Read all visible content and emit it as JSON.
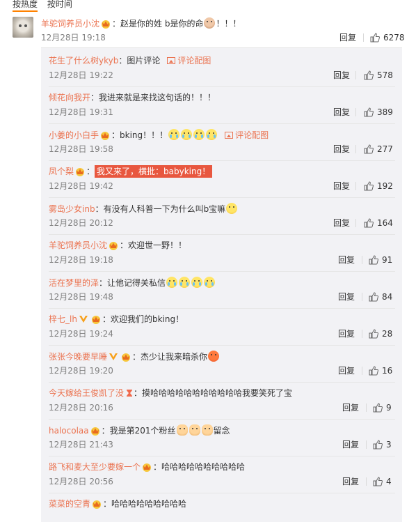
{
  "sort_tabs": [
    {
      "label": "按热度",
      "active": true
    },
    {
      "label": "按时间",
      "active": false
    }
  ],
  "colors": {
    "username": "#eb7350",
    "text": "#333333",
    "meta": "#808080",
    "highlight_bg": "#e8573f",
    "reply_bg": "#f2f2f5",
    "tab_underline": "#ff8200"
  },
  "main_comment": {
    "username": "羊驼饲养员小沈",
    "badges": [
      "vip-crown-icon"
    ],
    "text": "：赵是你的姓 b是你的命",
    "text_suffix": "！！！",
    "emoji_after": [
      "monkey-emoji"
    ],
    "time": "12月28日 19:18",
    "reply_label": "回复",
    "likes": "6278"
  },
  "replies": [
    {
      "username": "花生了什么树ykyb",
      "badges": [],
      "text": "：图片评论",
      "pic_link": "评论配图",
      "emojis": [],
      "time": "12月28日 19:22",
      "reply_label": "回复",
      "likes": "578"
    },
    {
      "username": "倾花向我开",
      "badges": [],
      "text": "：我进来就是来找这句话的！！！",
      "emojis": [],
      "time": "12月28日 19:31",
      "reply_label": "回复",
      "likes": "389"
    },
    {
      "username": "小姜的小白手",
      "badges": [
        "vip-crown-icon"
      ],
      "text": "：bking！！！",
      "pic_link": "评论配图",
      "emojis": [
        "cry-laugh-emoji",
        "cry-laugh-emoji",
        "cry-laugh-emoji",
        "cry-laugh-emoji"
      ],
      "time": "12月28日 19:58",
      "reply_label": "回复",
      "likes": "277"
    },
    {
      "username": "凤个梨",
      "badges": [
        "vip-crown-icon"
      ],
      "text": "：",
      "highlight": "我又来了，横批：babyking！",
      "emojis": [],
      "time": "12月28日 19:42",
      "reply_label": "回复",
      "likes": "192"
    },
    {
      "username": "雾岛少女inb",
      "badges": [],
      "text": "：有没有人科普一下为什么叫b宝嘛",
      "emojis": [
        "surprised-emoji"
      ],
      "time": "12月28日 20:12",
      "reply_label": "回复",
      "likes": "164"
    },
    {
      "username": "羊驼饲养员小沈",
      "badges": [
        "vip-crown-icon"
      ],
      "text": "：欢迎世一野！！",
      "emojis": [],
      "time": "12月28日 19:18",
      "reply_label": "回复",
      "likes": "91"
    },
    {
      "username": "活在梦里的泽",
      "badges": [],
      "text": "：让他记得关私信",
      "emojis": [
        "laugh-emoji",
        "laugh-emoji",
        "laugh-emoji",
        "laugh-emoji"
      ],
      "time": "12月28日 19:48",
      "reply_label": "回复",
      "likes": "84"
    },
    {
      "username": "梓七_lh",
      "badges": [
        "verified-v-icon",
        "vip-crown-icon"
      ],
      "text": "：欢迎我们的bking！",
      "emojis": [],
      "time": "12月28日 19:24",
      "reply_label": "回复",
      "likes": "28"
    },
    {
      "username": "张张今晚要早睡",
      "badges": [
        "verified-v-icon",
        "vip-crown-icon"
      ],
      "text": "：杰少让我来暗杀你",
      "emojis": [
        "angry-emoji"
      ],
      "time": "12月28日 19:20",
      "reply_label": "回复",
      "likes": "16"
    },
    {
      "username": "今天嫁给王俊凯了没",
      "badges": [
        "hourglass-icon"
      ],
      "text": "：摸哈哈哈哈哈哈哈哈哈哈哈我要笑死了宝",
      "emojis": [],
      "time": "12月28日 20:16",
      "reply_label": "回复",
      "likes": "9"
    },
    {
      "username": "halocolaa",
      "badges": [
        "vip-crown-icon"
      ],
      "text": "：我是第201个粉丝",
      "text_suffix": "留念",
      "emojis": [
        "fist-emoji",
        "fist-emoji",
        "fist-emoji"
      ],
      "time": "12月28日 21:43",
      "reply_label": "回复",
      "likes": "3"
    },
    {
      "username": "路飞和麦大至少要嫁一个",
      "badges": [
        "vip-crown-icon"
      ],
      "text": "：哈哈哈哈哈哈哈哈哈哈",
      "emojis": [],
      "time": "12月28日 20:56",
      "reply_label": "回复",
      "likes": "4"
    },
    {
      "username": "菜菜的空青",
      "badges": [
        "vip-crown-icon"
      ],
      "text": "：哈哈哈哈哈哈哈哈哈",
      "emojis": [],
      "time": "",
      "reply_label": "",
      "likes": ""
    }
  ]
}
